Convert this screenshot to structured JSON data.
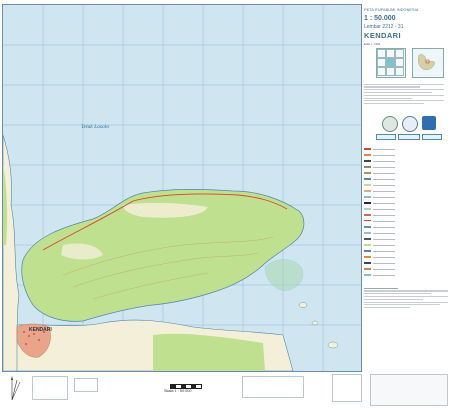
{
  "header": {
    "series_title": "PETA RUPABUMI INDONESIA",
    "scale": "1 : 50.000",
    "sheet_number": "Lembar 2212 - 31",
    "sheet_name": "KENDARI",
    "edition": "Edisi I - 1991"
  },
  "map": {
    "sea_label": "Teluk Lasolo",
    "city_label": "KENDARI",
    "colors": {
      "sea": "#cfe6f1",
      "land_vegetation": "#bfe08f",
      "land_open": "#f4efd9",
      "urban": "#e8a58b",
      "grid": "#8fb8cf",
      "road": "#d8452f",
      "contour": "#b98a5a"
    }
  },
  "footer": {
    "scale_note": "Skala 1 : 50.000"
  },
  "icons": [
    "north-arrow-icon",
    "institution-logo-icon",
    "eagle-logo-icon"
  ]
}
